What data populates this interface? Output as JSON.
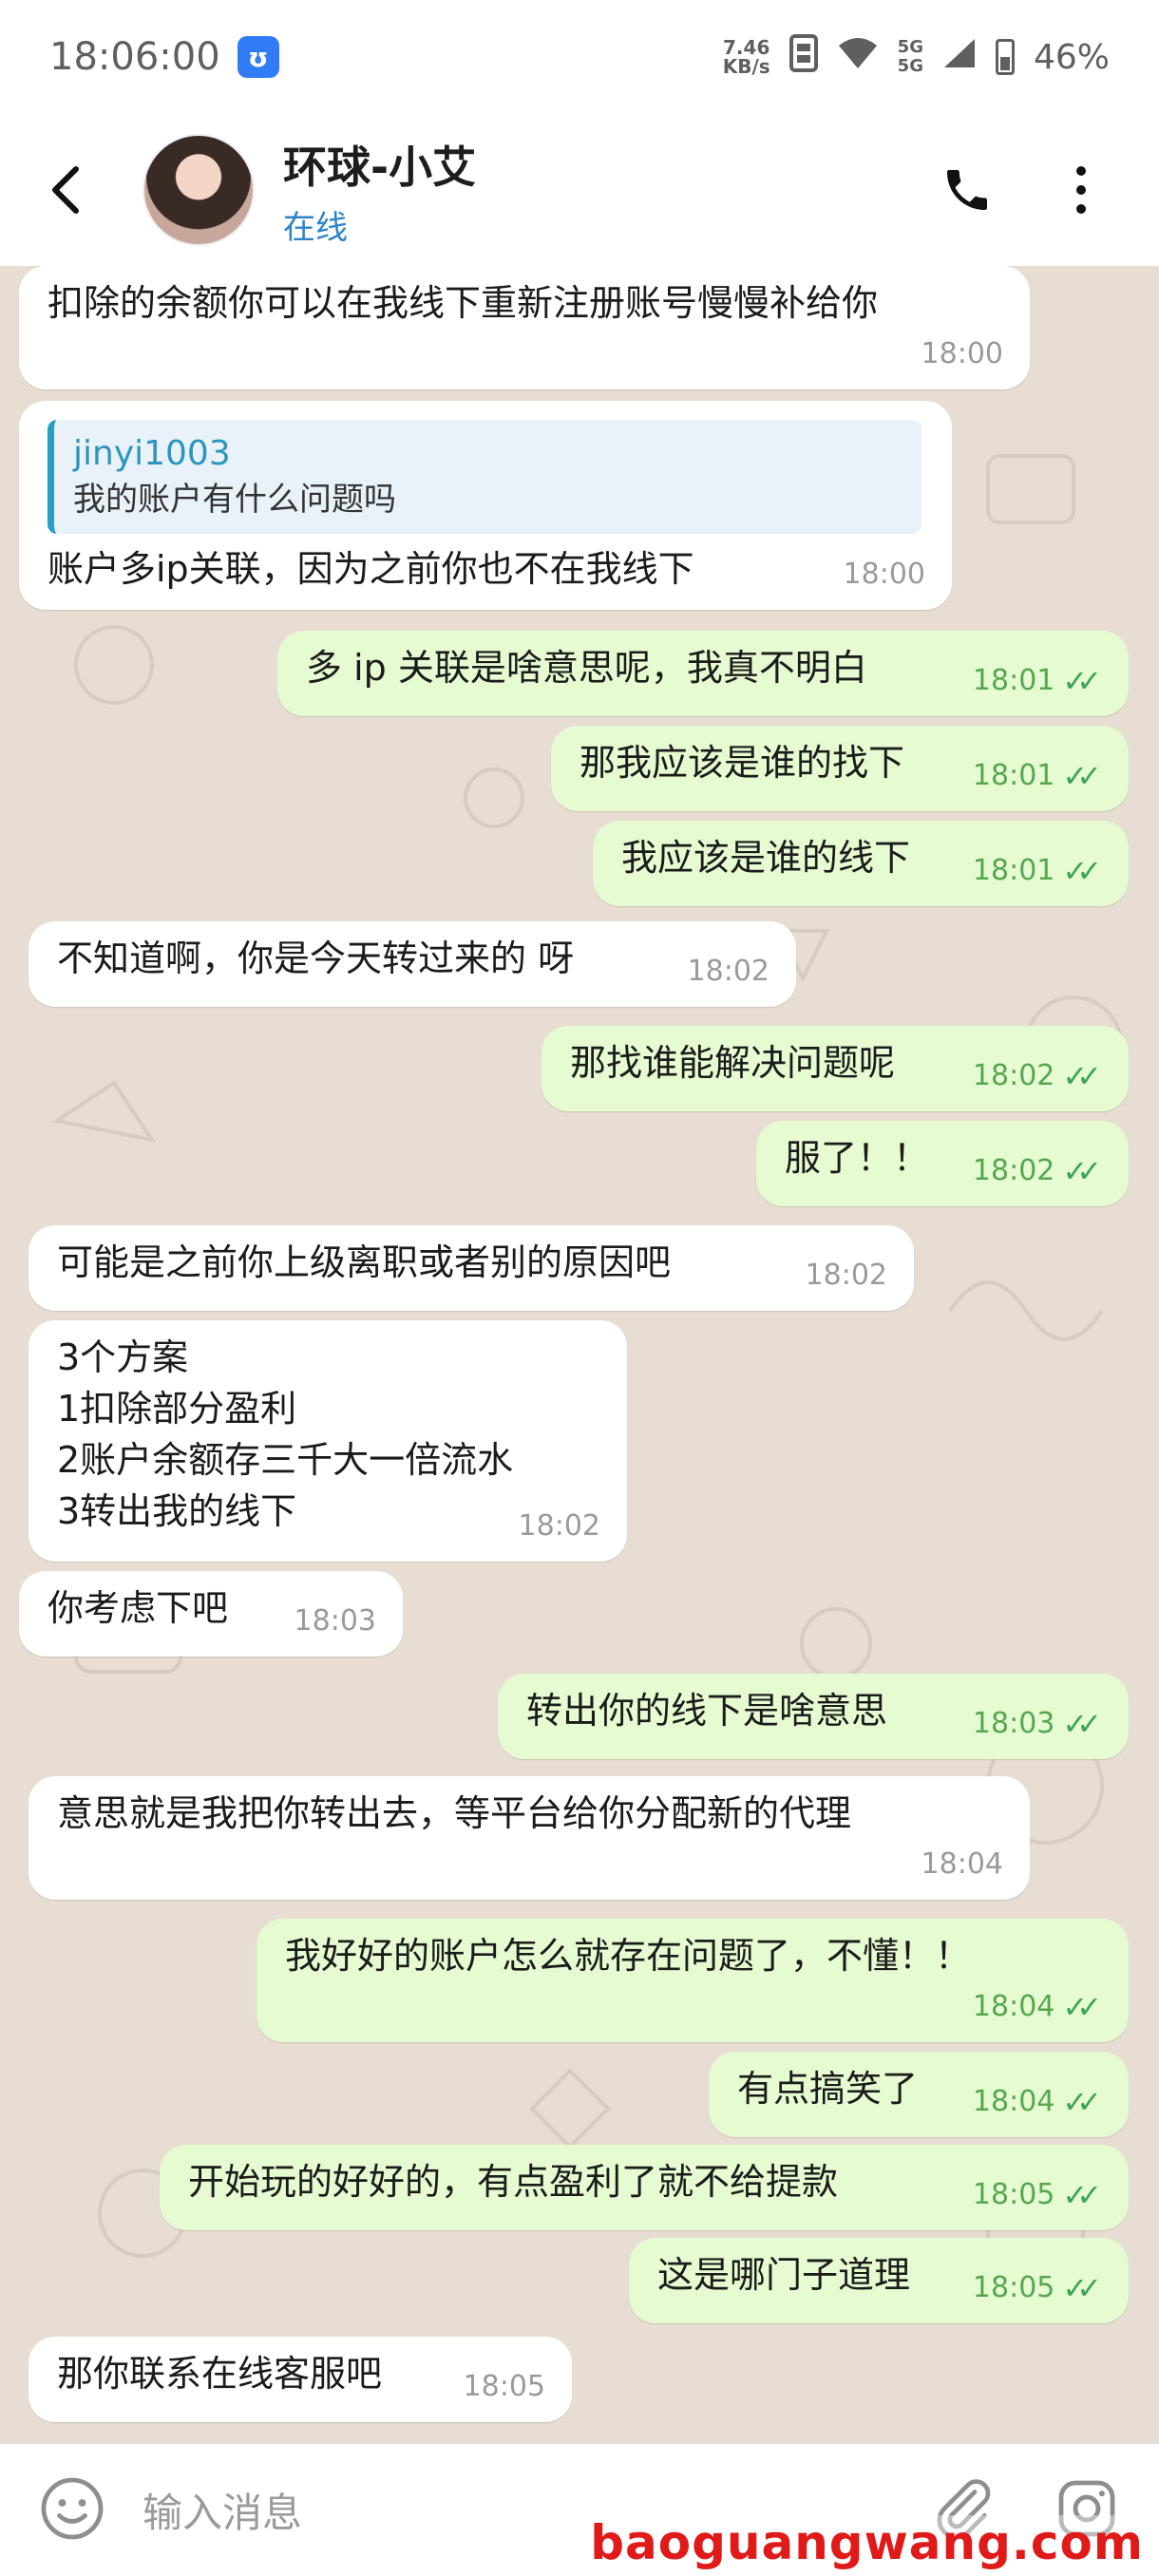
{
  "status_bar": {
    "time": "18:06:00",
    "app_badge": "ʊ",
    "speed_value": "7.46",
    "speed_unit": "KB/s",
    "network_a": "5G",
    "network_b": "5G",
    "battery": "46%"
  },
  "header": {
    "contact_name": "环球-小艾",
    "status": "在线",
    "icons": [
      "back-icon",
      "phone-icon",
      "more-vert-icon"
    ]
  },
  "messages": [
    {
      "dir": "in",
      "text": "扣除的余额你可以在我线下重新注册账号慢慢补给你",
      "time": "18:00"
    },
    {
      "dir": "in",
      "quote_user": "jinyi1003",
      "quote_text": "我的账户有什么问题吗",
      "text": "账户多ip关联，因为之前你也不在我线下",
      "time": "18:00"
    },
    {
      "dir": "out",
      "text": "多 ip 关联是啥意思呢，我真不明白",
      "time": "18:01"
    },
    {
      "dir": "out",
      "text": "那我应该是谁的找下",
      "time": "18:01"
    },
    {
      "dir": "out",
      "text": "我应该是谁的线下",
      "time": "18:01"
    },
    {
      "dir": "in",
      "text": "不知道啊，你是今天转过来的 呀",
      "time": "18:02"
    },
    {
      "dir": "out",
      "text": "那找谁能解决问题呢",
      "time": "18:02"
    },
    {
      "dir": "out",
      "text": "服了！！",
      "time": "18:02"
    },
    {
      "dir": "in",
      "text": "可能是之前你上级离职或者别的原因吧",
      "time": "18:02"
    },
    {
      "dir": "in",
      "text": "3个方案\n1扣除部分盈利\n2账户余额存三千大一倍流水\n3转出我的线下",
      "time": "18:02"
    },
    {
      "dir": "in",
      "text": "你考虑下吧",
      "time": "18:03"
    },
    {
      "dir": "out",
      "text": "转出你的线下是啥意思",
      "time": "18:03"
    },
    {
      "dir": "in",
      "text": "意思就是我把你转出去，等平台给你分配新的代理",
      "time": "18:04"
    },
    {
      "dir": "out",
      "text": "我好好的账户怎么就存在问题了，不懂！！",
      "time": "18:04"
    },
    {
      "dir": "out",
      "text": "有点搞笑了",
      "time": "18:04"
    },
    {
      "dir": "out",
      "text": "开始玩的好好的，有点盈利了就不给提款",
      "time": "18:05"
    },
    {
      "dir": "out",
      "text": "这是哪门子道理",
      "time": "18:05"
    },
    {
      "dir": "in",
      "text": "那你联系在线客服吧",
      "time": "18:05"
    }
  ],
  "input_bar": {
    "placeholder": "输入消息",
    "icons": [
      "emoji-icon",
      "attach-icon",
      "camera-icon"
    ]
  },
  "watermark": "baoguangwang.com",
  "colors": {
    "incoming_bubble": "#ffffff",
    "outgoing_bubble": "#e6fbd1",
    "tick": "#3ea35a",
    "link": "#2f83c9",
    "wallpaper": "#e7ddd2"
  }
}
